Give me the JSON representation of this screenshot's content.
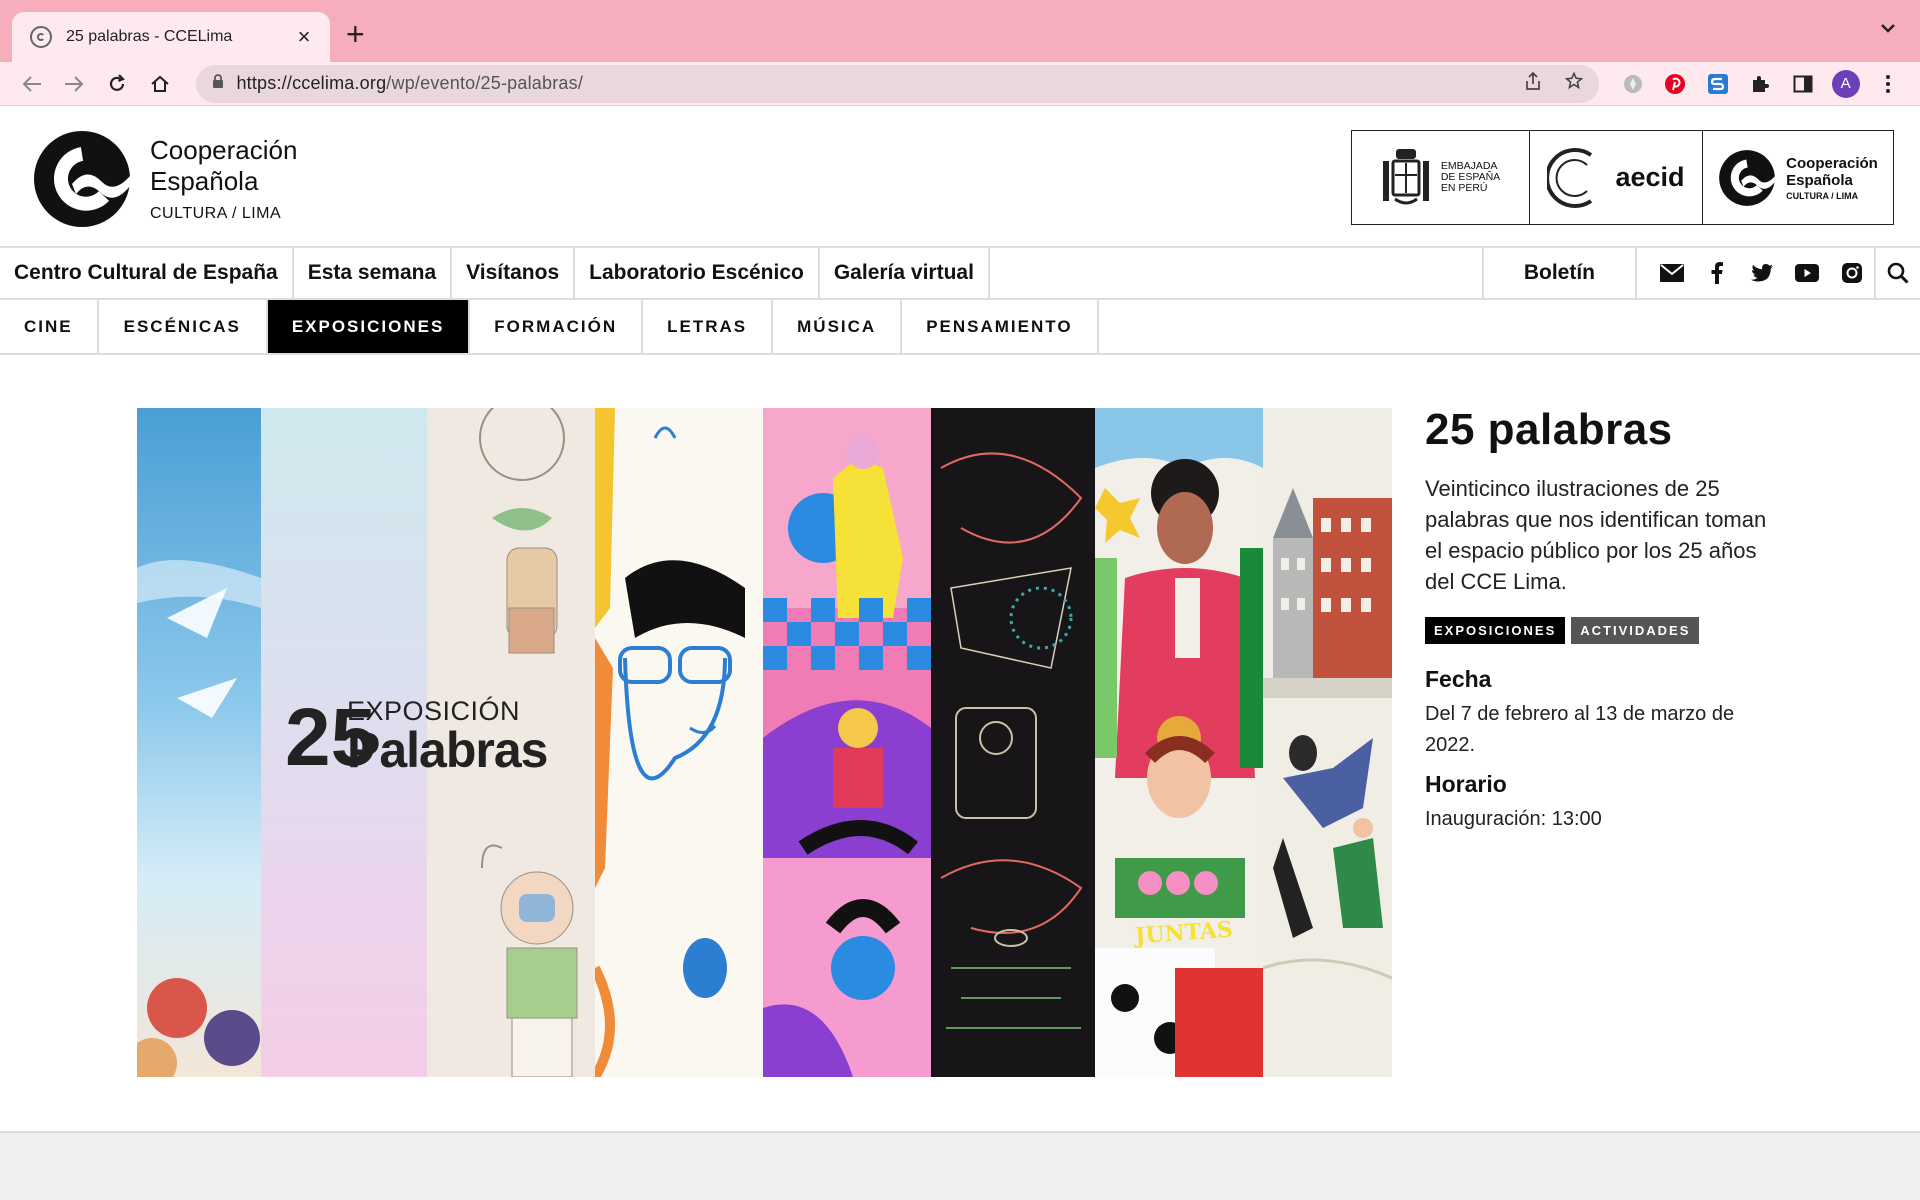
{
  "browser": {
    "tab_title": "25 palabras - CCELima",
    "url_host": "https://ccelima.org",
    "url_path": "/wp/evento/25-palabras/"
  },
  "header": {
    "logo_line1": "Cooperación",
    "logo_line2": "Española",
    "logo_line3": "CULTURA / LIMA",
    "partners": {
      "embassy_line1": "EMBAJADA",
      "embassy_line2": "DE ESPAÑA",
      "embassy_line3": "EN PERÚ",
      "aecid": "aecid",
      "coop_line1": "Cooperación",
      "coop_line2": "Española",
      "coop_line3": "CULTURA / LIMA"
    }
  },
  "mainnav": {
    "items": [
      {
        "label": "Centro Cultural de España"
      },
      {
        "label": "Esta semana"
      },
      {
        "label": "Visítanos"
      },
      {
        "label": "Laboratorio Escénico"
      },
      {
        "label": "Galería virtual"
      }
    ],
    "boletin": "Boletín"
  },
  "catnav": {
    "items": [
      {
        "label": "CINE"
      },
      {
        "label": "ESCÉNICAS"
      },
      {
        "label": "EXPOSICIONES"
      },
      {
        "label": "FORMACIÓN"
      },
      {
        "label": "LETRAS"
      },
      {
        "label": "MÚSICA"
      },
      {
        "label": "PENSAMIENTO"
      }
    ],
    "active": "EXPOSICIONES"
  },
  "hero": {
    "num": "25",
    "line1": "EXPOSICIÓN",
    "line2": "Palabras",
    "badge_text": "JUNTAS"
  },
  "event": {
    "title": "25 palabras",
    "description": "Veinticinco ilustraciones de 25 palabras que nos identifican toman el espacio público por los 25 años del CCE Lima.",
    "tags": [
      "EXPOSICIONES",
      "ACTIVIDADES"
    ],
    "date_heading": "Fecha",
    "date_value": "Del 7 de febrero al 13 de marzo de 2022.",
    "time_heading": "Horario",
    "time_value": "Inauguración: 13:00"
  },
  "colors": {
    "tabbar": "#f6aebd",
    "toolbar": "#fde9ee",
    "active_category": "#000000",
    "tag_secondary": "#555555"
  }
}
